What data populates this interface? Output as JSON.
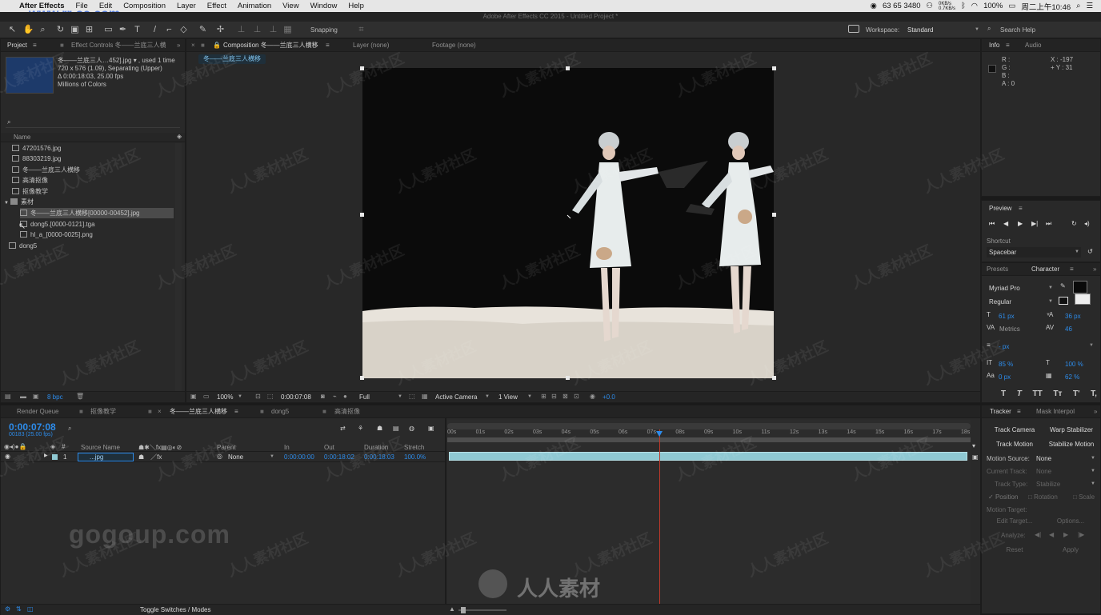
{
  "mac_menu": {
    "app": "After Effects",
    "items": [
      "File",
      "Edit",
      "Composition",
      "Layer",
      "Effect",
      "Animation",
      "View",
      "Window",
      "Help"
    ],
    "right": {
      "phone": "63 65 3480",
      "net_up": "0KB/s",
      "net_down": "0.7KB/s",
      "battery": "100%",
      "clock": "周二上午10:46"
    }
  },
  "window_title": "Adobe After Effects CC 2015 - Untitled Project *",
  "watermark_url": "www.rr-sc.com",
  "toolbar": {
    "snapping_label": "Snapping",
    "workspace_label": "Workspace:",
    "workspace_value": "Standard",
    "search_help": "Search Help"
  },
  "project_panel": {
    "tab_project": "Project",
    "tab_effect_controls": "Effect Controls 冬——兰底三人横移",
    "thumb_info": [
      "冬——兰底三人…452].jpg ▾ , used 1 time",
      "720 x 576 (1.09), Separating (Upper)",
      "Δ 0:00:18:03, 25.00 fps",
      "Millions of Colors"
    ],
    "column_name": "Name",
    "items": [
      "47201576.jpg",
      "88303219.jpg",
      "冬——兰底三人横移",
      "高清抠像",
      "抠像教学",
      "素材",
      "冬——兰底三人横移[00000-00452].jpg",
      "dong5.[0000-0121].tga",
      "hl_a_[0000-0025].png",
      "dong5"
    ],
    "bpc": "8 bpc"
  },
  "viewer": {
    "tab_composition": "Composition 冬——兰底三人横移",
    "tab_layer": "Layer (none)",
    "tab_footage": "Footage (none)",
    "breadcrumb": "冬——兰底三人横移",
    "zoom": "100%",
    "timecode": "0:00:07:08",
    "resolution": "Full",
    "camera": "Active Camera",
    "view": "1 View",
    "exposure": "+0.0"
  },
  "info_panel": {
    "tab_info": "Info",
    "tab_audio": "Audio",
    "channels": [
      "R :",
      "G :",
      "B :",
      "A : 0"
    ],
    "x": "X : -197",
    "y": "+ Y : 31"
  },
  "preview_panel": {
    "title": "Preview",
    "shortcut_label": "Shortcut",
    "shortcut_value": "Spacebar"
  },
  "character_panel": {
    "tab_presets": "Presets",
    "tab_character": "Character",
    "font": "Myriad Pro",
    "style": "Regular",
    "size": "61 px",
    "leading": "36 px",
    "kerning": "Metrics",
    "tracking": "46",
    "stroke": "- px",
    "vscale": "85 %",
    "hscale": "100 %",
    "baseline": "0 px",
    "tsume": "62 %",
    "type_buttons": [
      "T",
      "T",
      "TT",
      "Tт",
      "T'",
      "T,"
    ]
  },
  "tracker_panel": {
    "tab_tracker": "Tracker",
    "tab_mask": "Mask Interpol",
    "track_camera": "Track Camera",
    "warp_stabilizer": "Warp Stabilizer",
    "track_motion": "Track Motion",
    "stabilize_motion": "Stabilize Motion",
    "motion_source_label": "Motion Source:",
    "motion_source_value": "None",
    "current_track_label": "Current Track:",
    "current_track_value": "None",
    "track_type_label": "Track Type:",
    "track_type_value": "Stabilize",
    "position": "Position",
    "rotation": "Rotation",
    "scale": "Scale",
    "motion_target": "Motion Target:",
    "edit_target": "Edit Target...",
    "options": "Options...",
    "analyze": "Analyze:",
    "reset": "Reset",
    "apply": "Apply"
  },
  "timeline": {
    "tabs": [
      "Render Queue",
      "抠像教学",
      "冬——兰底三人横移",
      "dong5",
      "高清抠像"
    ],
    "timecode": "0:00:07:08",
    "frames": "00183 (25.00 fps)",
    "columns": {
      "source_name": "Source Name",
      "parent": "Parent",
      "in": "In",
      "out": "Out",
      "duration": "Duration",
      "stretch": "Stretch"
    },
    "layer": {
      "index": "1",
      "name": "...jpg",
      "parent": "None",
      "in": "0:00:00:00",
      "out": "0:00:18:02",
      "duration": "0:00:18:03",
      "stretch": "100.0%"
    },
    "ruler": [
      "00s",
      "01s",
      "02s",
      "03s",
      "04s",
      "05s",
      "06s",
      "07s",
      "08s",
      "09s",
      "10s",
      "11s",
      "12s",
      "13s",
      "14s",
      "15s",
      "16s",
      "17s",
      "18s"
    ],
    "current_time_seconds": 7.32,
    "total_seconds": 18.12,
    "toggle_modes": "Toggle Switches / Modes"
  },
  "brand_watermarks": {
    "left": "gogoup.com",
    "center": "人人素材",
    "diagonal": "人人素材社区"
  },
  "colors": {
    "accent": "#2d8ceb",
    "playhead": "#c0392b",
    "layer_bar": "#8fc9d3"
  }
}
